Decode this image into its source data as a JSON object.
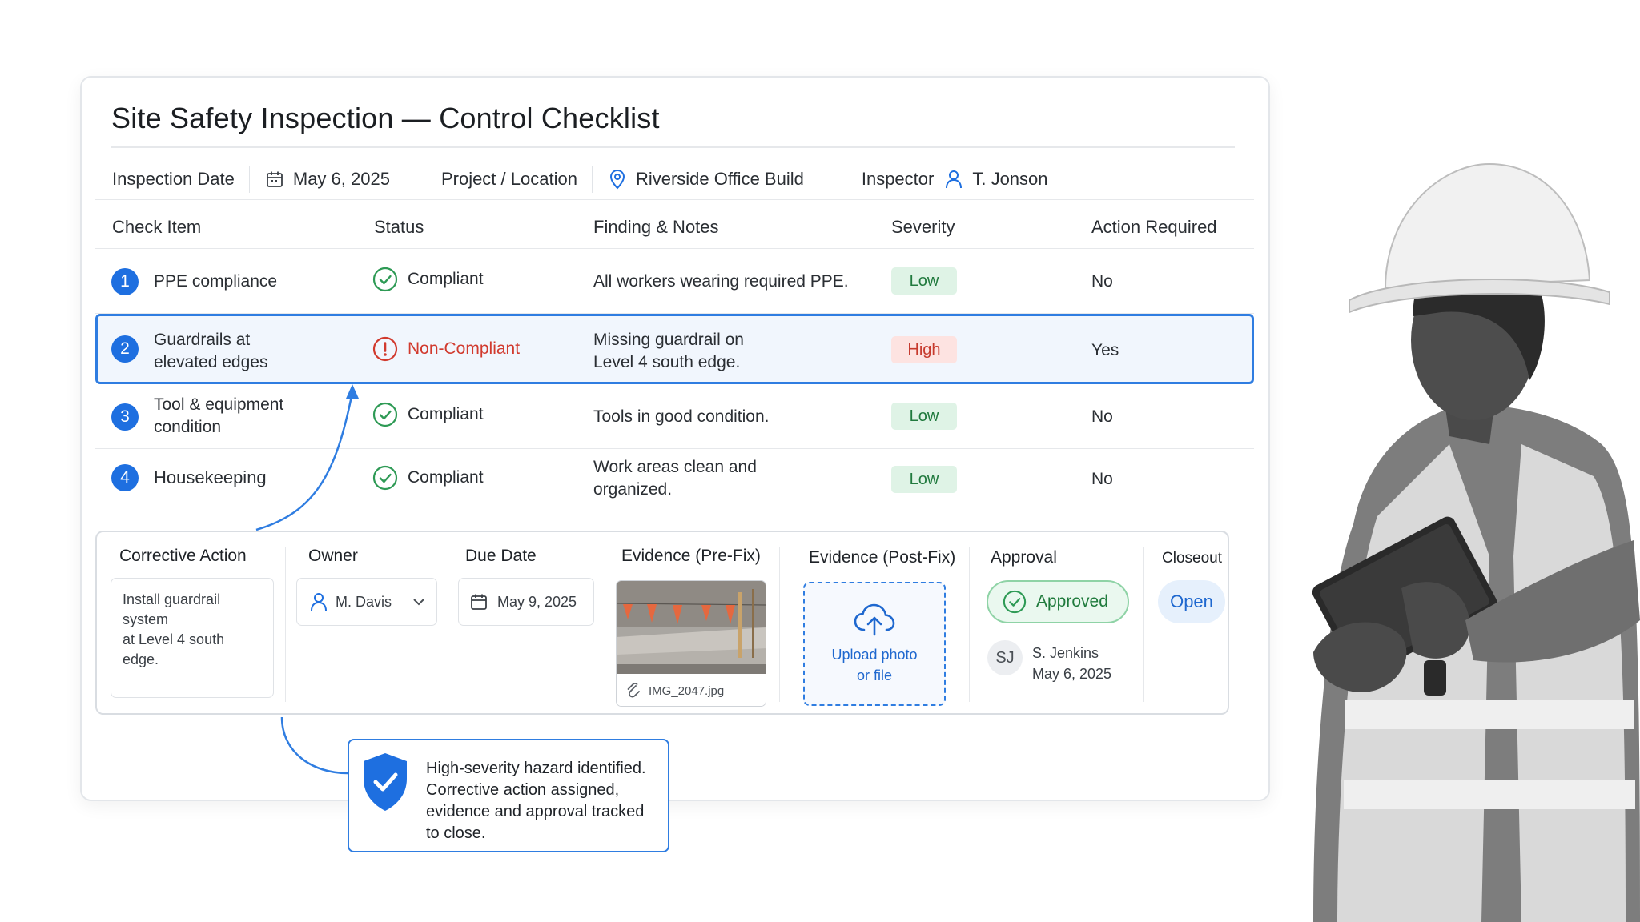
{
  "header": {
    "title": "Site Safety Inspection — Control Checklist"
  },
  "meta": {
    "date_label": "Inspection Date",
    "date_value": "May 6, 2025",
    "project_label": "Project / Location",
    "project_value": "Riverside Office Build",
    "inspector_label": "Inspector",
    "inspector_value": "T. Jonson"
  },
  "table": {
    "columns": [
      "Check Item",
      "Status",
      "Finding & Notes",
      "Severity",
      "Action Required"
    ],
    "rows": [
      {
        "num": "1",
        "item": "PPE compliance",
        "status": "Compliant",
        "finding": "All workers wearing required PPE.",
        "severity": "Low",
        "action": "No"
      },
      {
        "num": "2",
        "item_l1": "Guardrails at",
        "item_l2": "elevated edges",
        "status": "Non-Compliant",
        "finding_l1": "Missing guardrail on",
        "finding_l2": "Level 4 south edge.",
        "severity": "High",
        "action": "Yes"
      },
      {
        "num": "3",
        "item_l1": "Tool & equipment",
        "item_l2": "condition",
        "status": "Compliant",
        "finding": "Tools in good condition.",
        "severity": "Low",
        "action": "No"
      },
      {
        "num": "4",
        "item": "Housekeeping",
        "status": "Compliant",
        "finding_l1": "Work areas clean and",
        "finding_l2": "organized.",
        "severity": "Low",
        "action": "No"
      }
    ]
  },
  "action_panel": {
    "corrective_label": "Corrective Action",
    "corrective_l1": "Install guardrail system",
    "corrective_l2": "at Level 4 south edge.",
    "owner_label": "Owner",
    "owner_value": "M. Davis",
    "due_label": "Due Date",
    "due_value": "May 9, 2025",
    "evidence_pre_label": "Evidence (Pre-Fix)",
    "evidence_pre_file": "IMG_2047.jpg",
    "evidence_post_label": "Evidence (Post-Fix)",
    "upload_l1": "Upload photo",
    "upload_l2": "or file",
    "approval_label": "Approval",
    "approval_status": "Approved",
    "approver_initials": "SJ",
    "approver_name": "S. Jenkins",
    "approver_date": "May 6, 2025",
    "closeout_label": "Closeout",
    "closeout_status": "Open"
  },
  "callout": {
    "l1": "High-severity hazard identified.",
    "l2": "Corrective action assigned,",
    "l3": "evidence and approval tracked",
    "l4": "to close."
  },
  "colors": {
    "accent": "#1e6fe0",
    "compliant": "#2e9a55",
    "noncompliant": "#d13a2e",
    "low_bg": "#dff3e6",
    "high_bg": "#fde3e1"
  },
  "icons": [
    "calendar-icon",
    "location-pin-icon",
    "user-icon",
    "check-circle-icon",
    "alert-circle-icon",
    "chevron-down-icon",
    "paperclip-icon",
    "cloud-upload-icon",
    "shield-check-icon"
  ]
}
